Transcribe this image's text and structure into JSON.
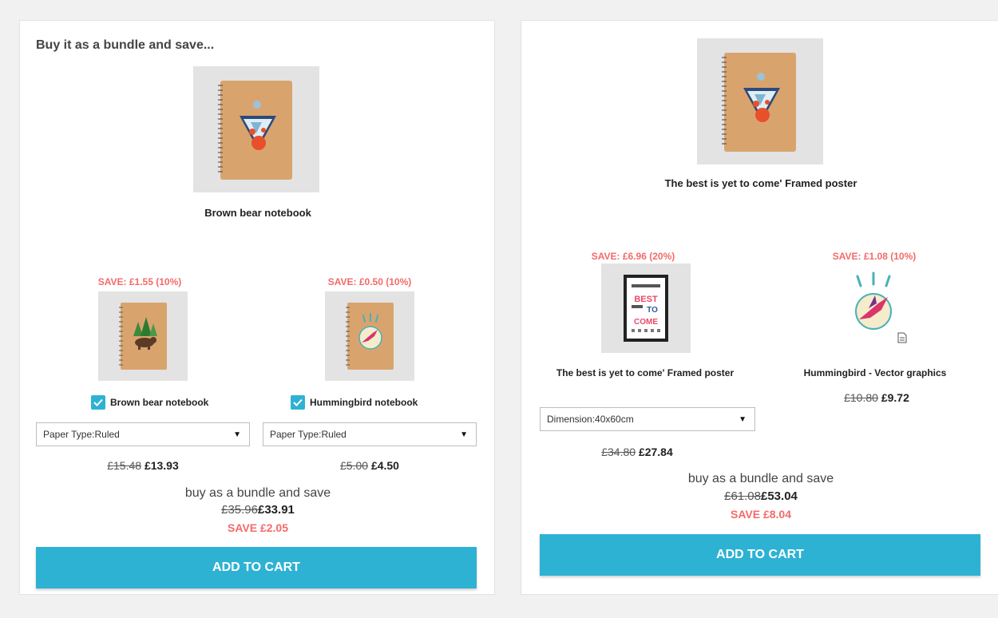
{
  "left_bundle": {
    "heading": "Buy it as a bundle and save...",
    "main_product": {
      "name": "Brown bear notebook"
    },
    "items": [
      {
        "save_label": "SAVE: £1.55 (10%)",
        "name": "Brown bear notebook",
        "checked": true,
        "select_value": "Paper Type:Ruled",
        "old_price": "£15.48",
        "new_price": "£13.93"
      },
      {
        "save_label": "SAVE: £0.50 (10%)",
        "name": "Hummingbird notebook",
        "checked": true,
        "select_value": "Paper Type:Ruled",
        "old_price": "£5.00",
        "new_price": "£4.50"
      }
    ],
    "bundle_text": "buy as a bundle and save",
    "total_old": "£35.96",
    "total_new": "£33.91",
    "save_total": "SAVE £2.05",
    "button_label": "ADD TO CART"
  },
  "right_bundle": {
    "main_product": {
      "name": "The best is yet to come' Framed poster"
    },
    "items": [
      {
        "save_label": "SAVE: £6.96 (20%)",
        "name": "The best is yet to come' Framed poster",
        "select_value": "Dimension:40x60cm",
        "old_price": "£34.80",
        "new_price": "£27.84"
      },
      {
        "save_label": "SAVE: £1.08 (10%)",
        "name": "Hummingbird - Vector graphics",
        "old_price": "£10.80",
        "new_price": "£9.72"
      }
    ],
    "bundle_text": "buy as a bundle and save",
    "total_old": "£61.08",
    "total_new": "£53.04",
    "save_total": "SAVE £8.04",
    "button_label": "ADD TO CART"
  },
  "poster_text": {
    "line1": "BEST",
    "line2": "TO",
    "line3": "COME"
  },
  "colors": {
    "accent": "#2eb2d3",
    "save_red": "#f46a6a",
    "notebook_kraft": "#d9a36e"
  }
}
